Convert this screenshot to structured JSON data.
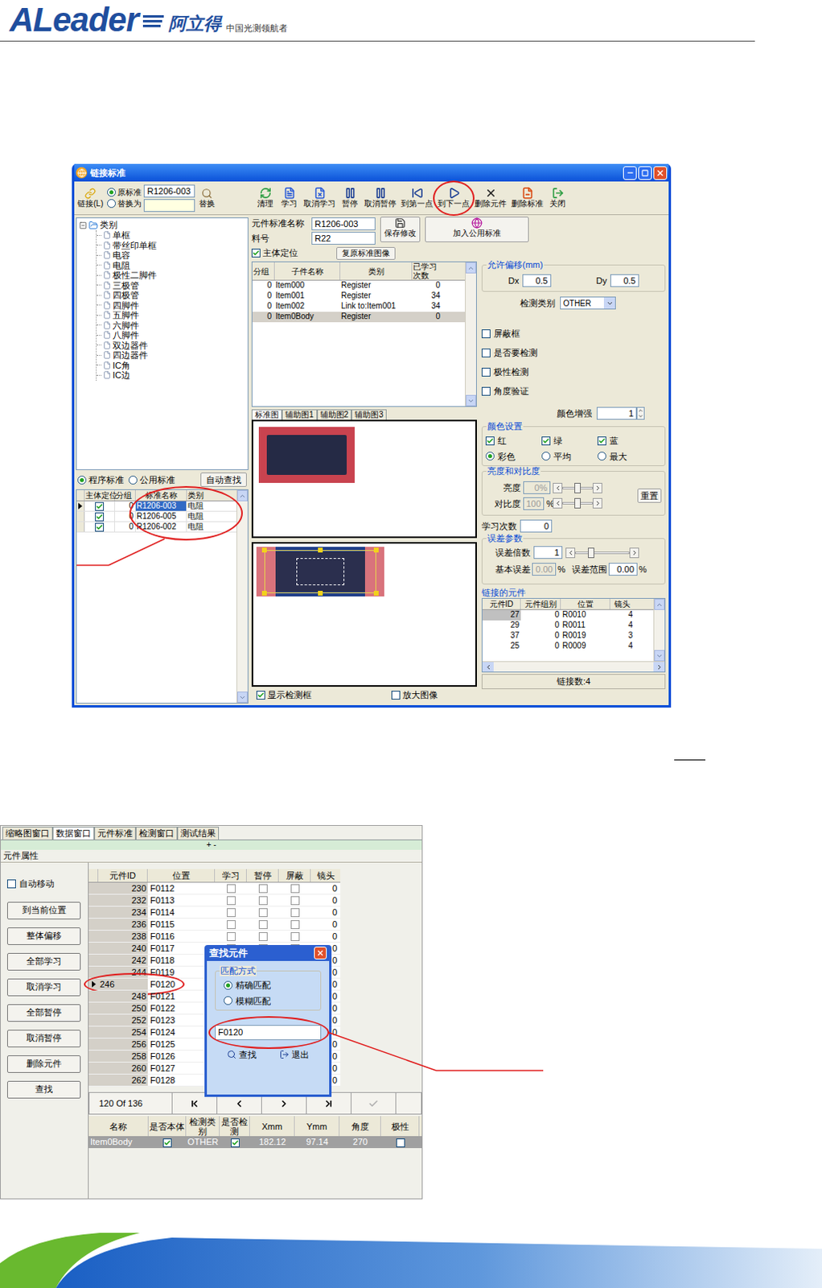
{
  "header": {
    "logo": "ALeader",
    "brand": "阿立得",
    "slogan": "中国光测领航者"
  },
  "link_window": {
    "title": "链接标准",
    "link_button": "链接(L)",
    "mode_options": [
      {
        "label": "原标准",
        "selected": true
      },
      {
        "label": "替换为",
        "selected": false
      }
    ],
    "source_value": "R1206-003",
    "target_value": "",
    "replace_button": "替换",
    "toolbar": [
      {
        "label": "清理",
        "annotated": false
      },
      {
        "label": "学习",
        "annotated": false
      },
      {
        "label": "取消学习",
        "annotated": false
      },
      {
        "label": "暂停",
        "annotated": false
      },
      {
        "label": "取消暂停",
        "annotated": false
      },
      {
        "label": "到第一点",
        "annotated": false
      },
      {
        "label": "到下一点",
        "annotated": true
      },
      {
        "label": "删除元件",
        "annotated": false
      },
      {
        "label": "删除标准",
        "annotated": false
      },
      {
        "label": "关闭",
        "annotated": false
      }
    ],
    "tree": {
      "root": "类别",
      "expanded": true,
      "items": [
        "单框",
        "带丝印单框",
        "电容",
        "电阻",
        "极性二脚件",
        "三极管",
        "四极管",
        "四脚件",
        "五脚件",
        "六脚件",
        "八脚件",
        "双边器件",
        "四边器件",
        "IC角",
        "IC边"
      ]
    },
    "standard_source": [
      {
        "label": "程序标准",
        "selected": true
      },
      {
        "label": "公用标准",
        "selected": false
      }
    ],
    "auto_find_button": "自动查找",
    "standards_table": {
      "annotated": true,
      "columns": [
        "主体定位",
        "分组",
        "标准名称",
        "类别"
      ],
      "rows": [
        {
          "main": true,
          "group": "0",
          "name": "R1206-003",
          "type": "电阻",
          "selected": true
        },
        {
          "main": true,
          "group": "0",
          "name": "R1206-005",
          "type": "电阻",
          "selected": false
        },
        {
          "main": true,
          "group": "0",
          "name": "R1206-002",
          "type": "电阻",
          "selected": false
        }
      ]
    },
    "component_name_label": "元件标准名称",
    "component_name": "R1206-003",
    "part_label": "料号",
    "part": "R22",
    "save_button": "保存修改",
    "add_public_button": "加入公用标准",
    "main_locate": {
      "label": "主体定位",
      "checked": true
    },
    "restore_button": "复原标准图像",
    "parts_table": {
      "columns": [
        "分组",
        "子件名称",
        "类别",
        "已学习次数"
      ],
      "rows": [
        {
          "group": "0",
          "name": "Item000",
          "type": "Register",
          "count": "0",
          "selected": false
        },
        {
          "group": "0",
          "name": "Item001",
          "type": "Register",
          "count": "34",
          "selected": false
        },
        {
          "group": "0",
          "name": "Item002",
          "type": "Link to:Item001",
          "count": "34",
          "selected": false
        },
        {
          "group": "0",
          "name": "Item0Body",
          "type": "Register",
          "count": "0",
          "selected": true
        }
      ]
    },
    "image_tabs": [
      {
        "label": "标准图",
        "selected": true
      },
      {
        "label": "辅助图1",
        "selected": false
      },
      {
        "label": "辅助图2",
        "selected": false
      },
      {
        "label": "辅助图3",
        "selected": false
      }
    ],
    "show_box": {
      "label": "显示检测框",
      "checked": true
    },
    "zoom": {
      "label": "放大图像",
      "checked": false
    },
    "offset": {
      "title": "允许偏移(mm)",
      "dx_label": "Dx",
      "dx": "0.5",
      "dy_label": "Dy",
      "dy": "0.5"
    },
    "detect_type": {
      "label": "检测类别",
      "value": "OTHER"
    },
    "options": [
      {
        "label": "屏蔽框",
        "checked": false
      },
      {
        "label": "是否要检测",
        "checked": false
      },
      {
        "label": "极性检测",
        "checked": false
      },
      {
        "label": "角度验证",
        "checked": false
      }
    ],
    "color_boost": {
      "label": "颜色增强",
      "value": "1"
    },
    "color_settings": {
      "title": "颜色设置",
      "channels": [
        {
          "label": "红",
          "checked": true
        },
        {
          "label": "绿",
          "checked": true
        },
        {
          "label": "蓝",
          "checked": true
        }
      ],
      "modes": [
        {
          "label": "彩色",
          "selected": true
        },
        {
          "label": "平均",
          "selected": false
        },
        {
          "label": "最大",
          "selected": false
        }
      ]
    },
    "brightness": {
      "title": "亮度和对比度",
      "brightness_label": "亮度",
      "brightness_value": "0%",
      "brightness_level": 0.5,
      "contrast_label": "对比度",
      "contrast_value": "100",
      "contrast_unit": "%",
      "contrast_level": 0.5,
      "reset": "重置"
    },
    "learn_count": {
      "label": "学习次数",
      "value": "0"
    },
    "error": {
      "title": "误差参数",
      "multiple_label": "误差倍数",
      "multiple": "1",
      "multiple_level": 0.3,
      "base_label": "基本误差",
      "base": "0.00",
      "base_unit": "%",
      "range_label": "误差范围",
      "range": "0.00",
      "range_unit": "%"
    },
    "linked": {
      "title": "链接的元件",
      "columns": [
        "元件ID",
        "元件组别",
        "位置",
        "镜头"
      ],
      "rows": [
        {
          "id": "27",
          "group": "0",
          "position": "R0010",
          "lens": "4",
          "selected": true
        },
        {
          "id": "29",
          "group": "0",
          "position": "R0011",
          "lens": "4",
          "selected": false
        },
        {
          "id": "37",
          "group": "0",
          "position": "R0019",
          "lens": "3",
          "selected": false
        },
        {
          "id": "25",
          "group": "0",
          "position": "R0009",
          "lens": "4",
          "selected": false
        }
      ],
      "count": "链接数:4"
    }
  },
  "data_window": {
    "tabs": [
      {
        "label": "缩略图窗口",
        "selected": false
      },
      {
        "label": "数据窗口",
        "selected": true
      },
      {
        "label": "元件标准",
        "selected": false
      },
      {
        "label": "检测窗口",
        "selected": false
      },
      {
        "label": "测试结果",
        "selected": false
      }
    ],
    "splitter": "+ -",
    "section": "元件属性",
    "auto_move": {
      "label": "自动移动",
      "checked": false
    },
    "buttons": [
      "到当前位置",
      "整体偏移",
      "全部学习",
      "取消学习",
      "全部暂停",
      "取消暂停",
      "删除元件",
      "查找"
    ],
    "table": {
      "columns": [
        "元件ID",
        "位置",
        "学习",
        "暂停",
        "屏蔽",
        "镜头"
      ],
      "rows": [
        {
          "id": "230",
          "position": "F0112",
          "learn": false,
          "pause": false,
          "shield": false,
          "lens": "0",
          "selected": false,
          "annotated": false
        },
        {
          "id": "232",
          "position": "F0113",
          "learn": false,
          "pause": false,
          "shield": false,
          "lens": "0",
          "selected": false,
          "annotated": false
        },
        {
          "id": "234",
          "position": "F0114",
          "learn": false,
          "pause": false,
          "shield": false,
          "lens": "0",
          "selected": false,
          "annotated": false
        },
        {
          "id": "236",
          "position": "F0115",
          "learn": false,
          "pause": false,
          "shield": false,
          "lens": "0",
          "selected": false,
          "annotated": false
        },
        {
          "id": "238",
          "position": "F0116",
          "learn": false,
          "pause": false,
          "shield": false,
          "lens": "0",
          "selected": false,
          "annotated": false
        },
        {
          "id": "240",
          "position": "F0117",
          "learn": false,
          "pause": false,
          "shield": false,
          "lens": "0",
          "selected": false,
          "annotated": false
        },
        {
          "id": "242",
          "position": "F0118",
          "learn": false,
          "pause": false,
          "shield": false,
          "lens": "0",
          "selected": false,
          "annotated": false
        },
        {
          "id": "244",
          "position": "F0119",
          "learn": false,
          "pause": false,
          "shield": false,
          "lens": "0",
          "selected": false,
          "annotated": false
        },
        {
          "id": "246",
          "position": "F0120",
          "learn": false,
          "pause": false,
          "shield": false,
          "lens": "0",
          "selected": true,
          "annotated": true
        },
        {
          "id": "248",
          "position": "F0121",
          "learn": false,
          "pause": false,
          "shield": false,
          "lens": "0",
          "selected": false,
          "annotated": false
        },
        {
          "id": "250",
          "position": "F0122",
          "learn": false,
          "pause": false,
          "shield": false,
          "lens": "0",
          "selected": false,
          "annotated": false
        },
        {
          "id": "252",
          "position": "F0123",
          "learn": false,
          "pause": false,
          "shield": false,
          "lens": "0",
          "selected": false,
          "annotated": false
        },
        {
          "id": "254",
          "position": "F0124",
          "learn": false,
          "pause": false,
          "shield": false,
          "lens": "0",
          "selected": false,
          "annotated": false
        },
        {
          "id": "256",
          "position": "F0125",
          "learn": false,
          "pause": false,
          "shield": false,
          "lens": "0",
          "selected": false,
          "annotated": false
        },
        {
          "id": "258",
          "position": "F0126",
          "learn": false,
          "pause": false,
          "shield": false,
          "lens": "0",
          "selected": false,
          "annotated": false
        },
        {
          "id": "260",
          "position": "F0127",
          "learn": false,
          "pause": false,
          "shield": false,
          "lens": "0",
          "selected": false,
          "annotated": false
        },
        {
          "id": "262",
          "position": "F0128",
          "learn": false,
          "pause": false,
          "shield": false,
          "lens": "0",
          "selected": false,
          "annotated": false
        }
      ]
    },
    "nav": {
      "record": "120 Of 136",
      "buttons": [
        {
          "kind": "first",
          "disabled": false
        },
        {
          "kind": "prev",
          "disabled": false
        },
        {
          "kind": "next",
          "disabled": false
        },
        {
          "kind": "last",
          "disabled": false
        },
        {
          "kind": "apply",
          "disabled": true
        }
      ]
    },
    "part_table": {
      "columns": [
        "名称",
        "是否本体",
        "检测类别",
        "是否检测",
        "Xmm",
        "Ymm",
        "角度",
        "极性"
      ],
      "rows": [
        {
          "name": "Item0Body",
          "is_body": true,
          "detect_type": "OTHER",
          "detect": true,
          "x": "182.12",
          "y": "97.14",
          "angle": "270",
          "polarity": false,
          "selected": true
        }
      ]
    },
    "find_dialog": {
      "title": "查找元件",
      "group": "匹配方式",
      "modes": [
        {
          "label": "精确匹配",
          "selected": true
        },
        {
          "label": "模糊匹配",
          "selected": false
        }
      ],
      "value": "F0120",
      "annotated": true,
      "find": "查找",
      "exit": "退出"
    }
  }
}
